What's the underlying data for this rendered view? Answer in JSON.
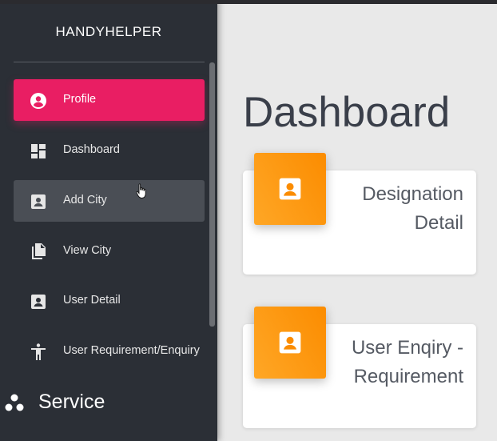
{
  "sidebar": {
    "brand": "HANDYHELPER",
    "items": [
      {
        "label": "Profile",
        "icon": "account-circle-icon"
      },
      {
        "label": "Dashboard",
        "icon": "dashboard-icon"
      },
      {
        "label": "Add City",
        "icon": "contact-card-icon"
      },
      {
        "label": "View City",
        "icon": "file-copy-icon"
      },
      {
        "label": "User Detail",
        "icon": "contact-card-icon"
      },
      {
        "label": "User Requirement/Enquiry",
        "icon": "accessibility-icon"
      }
    ],
    "service": {
      "label": "Service",
      "icon": "bubble-chart-icon"
    }
  },
  "main": {
    "title": "Dashboard",
    "cards": [
      {
        "title": "Designation Detail",
        "icon": "contact-card-icon"
      },
      {
        "title": "User Enqiry - Requirement",
        "icon": "contact-card-icon"
      }
    ]
  },
  "colors": {
    "accent": "#e91e63",
    "card_badge": "#fb8c00",
    "sidebar_bg": "#2b2f36"
  }
}
